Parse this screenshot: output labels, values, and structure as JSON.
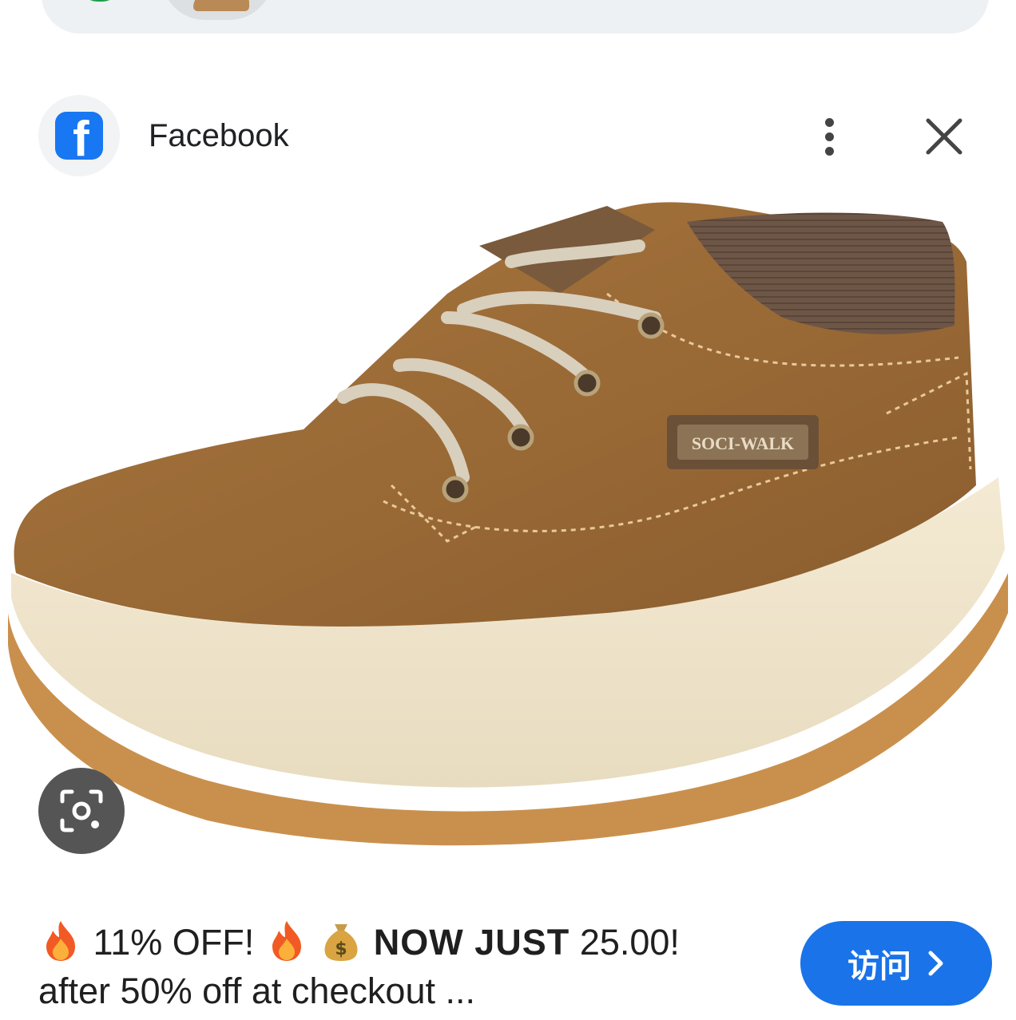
{
  "header": {
    "source_name": "Facebook",
    "logo_letter": "f",
    "more_icon": "more-vert-icon",
    "close_icon": "close-icon"
  },
  "product": {
    "brand_tag": "SOCI-WALK",
    "lens_icon": "google-lens-icon"
  },
  "caption": {
    "line1_part1": "11% OFF!",
    "line1_bold": "NOW JUST",
    "line1_price": "25.00!",
    "line2": "after 50% off at checkout ..."
  },
  "visit_button": {
    "label": "访问",
    "icon": "chevron-right-icon"
  },
  "colors": {
    "accent": "#1a73e8",
    "facebook_blue": "#1877f2"
  }
}
